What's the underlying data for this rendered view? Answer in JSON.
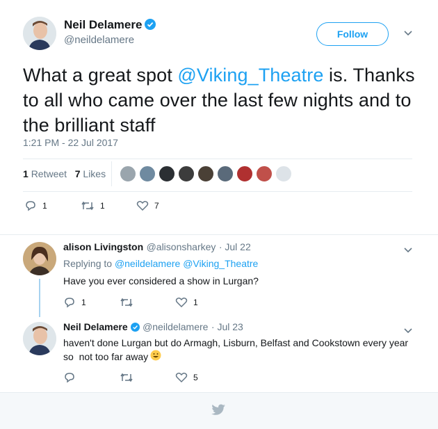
{
  "tweet": {
    "author_name": "Neil Delamere",
    "author_handle": "@neildelamere",
    "follow_label": "Follow",
    "text_before": "What a great spot ",
    "text_mention": "@Viking_Theatre",
    "text_after": " is. Thanks to all who came over the last few nights and to the brilliant staff",
    "timestamp": "1:21 PM - 22 Jul 2017",
    "retweet_count": "1",
    "retweet_label": "Retweet",
    "likes_count": "7",
    "likes_label": "Likes",
    "reply_count": "1",
    "retweet_action_count": "1",
    "like_action_count": "7"
  },
  "replies": [
    {
      "author_name": "alison Livingston",
      "author_handle": "@alisonsharkey",
      "date": "· Jul 22",
      "replying_label": "Replying to",
      "replying_to_1": "@neildelamere",
      "replying_to_2": "@Viking_Theatre",
      "text": "Have you ever considered a show in Lurgan?",
      "reply_count": "1",
      "like_count": "1"
    },
    {
      "author_name": "Neil Delamere",
      "author_handle": "@neildelamere",
      "date": "· Jul 23",
      "text_line1": "haven't done Lurgan but do Armagh, Lisburn, Belfast and Cookstown every year",
      "text_line2": "so  not too far away",
      "like_count": "5"
    }
  ],
  "icons": [
    "verified-badge-icon",
    "chevron-down-icon",
    "reply-icon",
    "retweet-icon",
    "heart-icon",
    "smile-emoji-icon",
    "twitter-bird-icon"
  ],
  "colors": {
    "accent": "#1da1f2",
    "muted": "#657786",
    "thread_line": "#a6d2f0",
    "footer_bg": "#f5f8fa"
  }
}
